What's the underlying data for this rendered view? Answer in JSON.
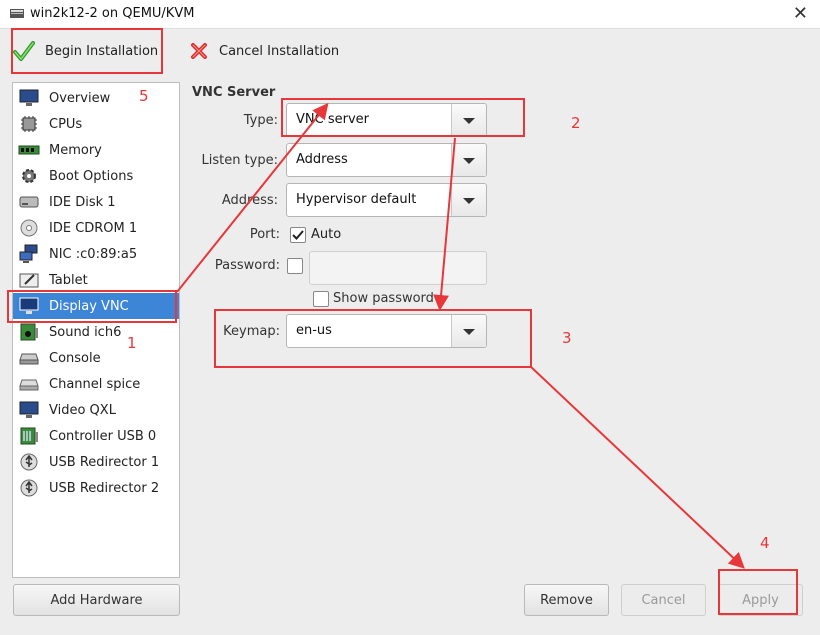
{
  "window": {
    "title": "win2k12-2 on QEMU/KVM"
  },
  "toolbar": {
    "begin_label": "Begin Installation",
    "cancel_label": "Cancel Installation"
  },
  "sidebar": {
    "items": [
      {
        "label": "Overview",
        "icon": "monitor-icon"
      },
      {
        "label": "CPUs",
        "icon": "cpu-icon"
      },
      {
        "label": "Memory",
        "icon": "memory-icon"
      },
      {
        "label": "Boot Options",
        "icon": "gear-icon"
      },
      {
        "label": "IDE Disk 1",
        "icon": "disk-icon"
      },
      {
        "label": "IDE CDROM 1",
        "icon": "cdrom-icon"
      },
      {
        "label": "NIC :c0:89:a5",
        "icon": "network-icon"
      },
      {
        "label": "Tablet",
        "icon": "tablet-icon"
      },
      {
        "label": "Display VNC",
        "icon": "display-icon",
        "selected": true
      },
      {
        "label": "Sound ich6",
        "icon": "sound-icon"
      },
      {
        "label": "Console",
        "icon": "console-icon"
      },
      {
        "label": "Channel spice",
        "icon": "channel-icon"
      },
      {
        "label": "Video QXL",
        "icon": "video-icon"
      },
      {
        "label": "Controller USB 0",
        "icon": "controller-icon"
      },
      {
        "label": "USB Redirector 1",
        "icon": "usb-icon"
      },
      {
        "label": "USB Redirector 2",
        "icon": "usb-icon"
      }
    ],
    "add_hardware_label": "Add Hardware"
  },
  "vnc": {
    "section_title": "VNC Server",
    "type_label": "Type:",
    "type_value": "VNC server",
    "listen_type_label": "Listen type:",
    "listen_type_value": "Address",
    "address_label": "Address:",
    "address_value": "Hypervisor default",
    "port_label": "Port:",
    "port_auto_label": "Auto",
    "port_auto_checked": true,
    "password_label": "Password:",
    "password_checked": false,
    "show_password_label": "Show password",
    "keymap_label": "Keymap:",
    "keymap_value": "en-us"
  },
  "buttons": {
    "remove": "Remove",
    "cancel": "Cancel",
    "apply": "Apply"
  },
  "annotations": [
    "1",
    "2",
    "3",
    "4",
    "5"
  ],
  "colors": {
    "selection": "#3d85d6",
    "annotation_red": "#e8373a"
  }
}
